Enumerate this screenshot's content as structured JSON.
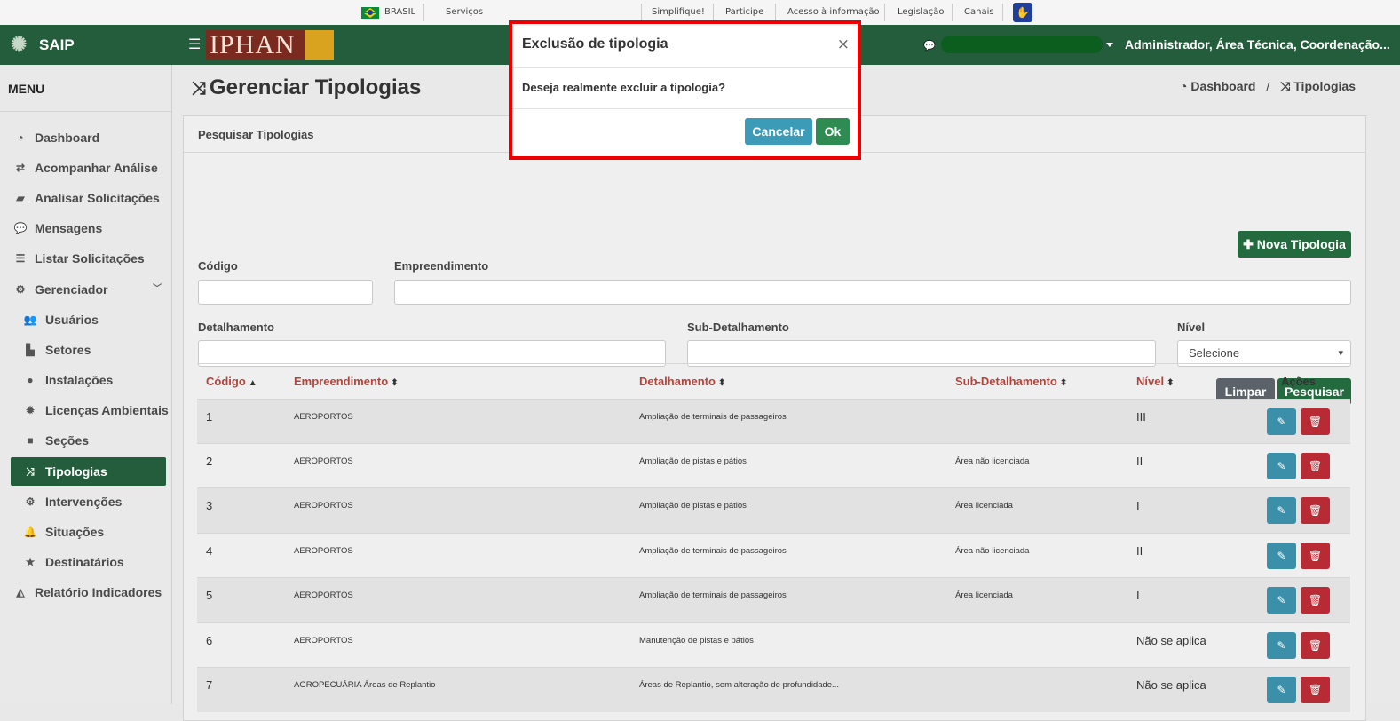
{
  "govbar": {
    "brasil": "BRASIL",
    "servicos": "Serviços",
    "links": [
      "Simplifique!",
      "Participe",
      "Acesso à informação",
      "Legislação",
      "Canais"
    ]
  },
  "header": {
    "app_name": "SAIP",
    "logo_text": "IPHAN",
    "user_label": "Administrador, Área Técnica, Coordenação..."
  },
  "sidebar": {
    "menu_title": "MENU",
    "items": [
      {
        "label": "Dashboard",
        "icon": "dashboard-icon"
      },
      {
        "label": "Acompanhar Análise",
        "icon": "exchange-icon"
      },
      {
        "label": "Analisar Solicitações",
        "icon": "book-icon"
      },
      {
        "label": "Mensagens",
        "icon": "comments-icon"
      },
      {
        "label": "Listar Solicitações",
        "icon": "list-icon"
      },
      {
        "label": "Gerenciador",
        "icon": "gears-icon"
      },
      {
        "label": "Usuários",
        "icon": "users-icon"
      },
      {
        "label": "Setores",
        "icon": "bar-chart-icon"
      },
      {
        "label": "Instalações",
        "icon": "circle-icon"
      },
      {
        "label": "Licenças Ambientais",
        "icon": "certificate-icon"
      },
      {
        "label": "Seções",
        "icon": "square-icon"
      },
      {
        "label": "Tipologias",
        "icon": "shuffle-icon"
      },
      {
        "label": "Intervenções",
        "icon": "cog-icon"
      },
      {
        "label": "Situações",
        "icon": "bell-icon"
      },
      {
        "label": "Destinatários",
        "icon": "star-icon"
      },
      {
        "label": "Relatório Indicadores",
        "icon": "area-chart-icon"
      }
    ]
  },
  "page": {
    "title": "Gerenciar Tipologias",
    "breadcrumb": [
      "Dashboard",
      "Tipologias"
    ]
  },
  "search": {
    "card_title": "Pesquisar Tipologias",
    "new_button": "Nova Tipologia",
    "labels": {
      "codigo": "Código",
      "empreendimento": "Empreendimento",
      "detalhamento": "Detalhamento",
      "subdetalhamento": "Sub-Detalhamento",
      "nivel": "Nível"
    },
    "nivel_selected": "Selecione",
    "clear_button": "Limpar",
    "search_button": "Pesquisar"
  },
  "table": {
    "headers": [
      "Código",
      "Empreendimento",
      "Detalhamento",
      "Sub-Detalhamento",
      "Nível",
      "Ações"
    ],
    "rows": [
      {
        "codigo": "1",
        "empreendimento": "AEROPORTOS",
        "detalhamento": "Ampliação de terminais de passageiros",
        "sub": "",
        "nivel": "III"
      },
      {
        "codigo": "2",
        "empreendimento": "AEROPORTOS",
        "detalhamento": "Ampliação de pistas e pátios",
        "sub": "Área não licenciada",
        "nivel": "II"
      },
      {
        "codigo": "3",
        "empreendimento": "AEROPORTOS",
        "detalhamento": "Ampliação de pistas e pátios",
        "sub": "Área licenciada",
        "nivel": "I"
      },
      {
        "codigo": "4",
        "empreendimento": "AEROPORTOS",
        "detalhamento": "Ampliação de terminais de passageiros",
        "sub": "Área não licenciada",
        "nivel": "II"
      },
      {
        "codigo": "5",
        "empreendimento": "AEROPORTOS",
        "detalhamento": "Ampliação de terminais de passageiros",
        "sub": "Área licenciada",
        "nivel": "I"
      },
      {
        "codigo": "6",
        "empreendimento": "AEROPORTOS",
        "detalhamento": "Manutenção de pistas e pátios",
        "sub": "",
        "nivel": "Não se aplica"
      },
      {
        "codigo": "7",
        "empreendimento": "AGROPECUÁRIA Áreas de Replantio",
        "detalhamento": "Áreas de Replantio, sem alteração de profundidade...",
        "sub": "",
        "nivel": "Não se aplica"
      }
    ]
  },
  "modal": {
    "title": "Exclusão de tipologia",
    "close": "×",
    "body": "Deseja realmente excluir a tipologia?",
    "cancel": "Cancelar",
    "ok": "Ok"
  },
  "colors": {
    "brand_green": "#235d3b",
    "header_sort_red": "#b5433b",
    "modal_highlight": "#ef0000"
  }
}
